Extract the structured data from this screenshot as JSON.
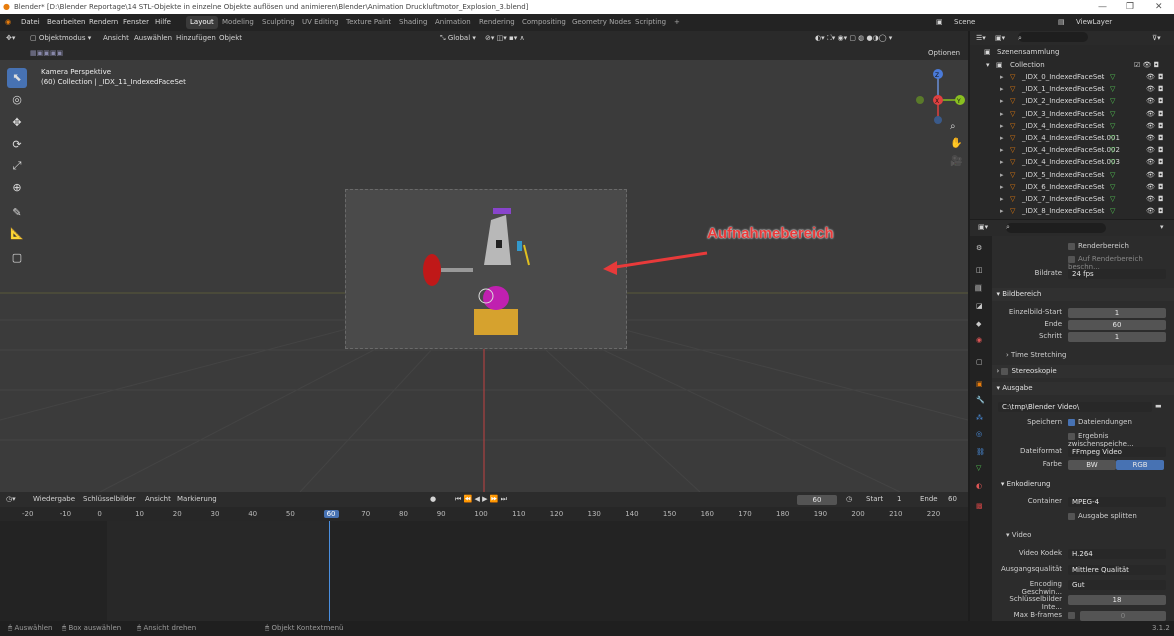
{
  "titlebar": {
    "title": "Blender* [D:\\Blender Reportage\\14 STL-Objekte in einzelne Objekte auflösen und animieren\\Blender\\Animation Druckluftmotor_Explosion_3.blend]",
    "minimize": "—",
    "maximize": "❐",
    "close": "✕"
  },
  "menu": [
    "Datei",
    "Bearbeiten",
    "Rendern",
    "Fenster",
    "Hilfe"
  ],
  "workspaces": [
    "Layout",
    "Modeling",
    "Sculpting",
    "UV Editing",
    "Texture Paint",
    "Shading",
    "Animation",
    "Rendering",
    "Compositing",
    "Geometry Nodes",
    "Scripting",
    "+"
  ],
  "scene": {
    "label": "Scene",
    "viewlayer": "ViewLayer"
  },
  "viewport_header": {
    "mode": "Objektmodus",
    "menus": [
      "Ansicht",
      "Auswählen",
      "Hinzufügen",
      "Objekt"
    ],
    "transform": "Global",
    "optionen": "Optionen"
  },
  "viewport": {
    "view_name": "Kamera Perspektive",
    "collection_line": "(60) Collection | _IDX_11_IndexedFaceSet",
    "annotation": "Aufnahmebereich",
    "gizmo": [
      "Z",
      "Y",
      "X"
    ]
  },
  "timeline": {
    "playback": "Wiedergabe",
    "keying": "Schlüsselbilder",
    "view": "Ansicht",
    "marker": "Markierung",
    "current_frame": "60",
    "start_label": "Start",
    "start": "1",
    "end_label": "Ende",
    "end": "60",
    "ticks": [
      "-20",
      "-10",
      "0",
      "10",
      "20",
      "30",
      "40",
      "50",
      "60",
      "70",
      "80",
      "90",
      "100",
      "110",
      "120",
      "130",
      "140",
      "150",
      "160",
      "170",
      "180",
      "190",
      "200",
      "210",
      "220"
    ]
  },
  "statusbar": {
    "select": "Auswählen",
    "box": "Box auswählen",
    "rotate": "Ansicht drehen",
    "context": "Objekt Kontextmenü",
    "version": "3.1.2"
  },
  "outliner": {
    "header": "Szenensammlung",
    "collection": "Collection",
    "items": [
      "_IDX_0_IndexedFaceSet",
      "_IDX_1_IndexedFaceSet",
      "_IDX_2_IndexedFaceSet",
      "_IDX_3_IndexedFaceSet",
      "_IDX_4_IndexedFaceSet",
      "_IDX_4_IndexedFaceSet.001",
      "_IDX_4_IndexedFaceSet.002",
      "_IDX_4_IndexedFaceSet.003",
      "_IDX_5_IndexedFaceSet",
      "_IDX_6_IndexedFaceSet",
      "_IDX_7_IndexedFaceSet",
      "_IDX_8_IndexedFaceSet"
    ]
  },
  "props": {
    "renderbereich": "Renderbereich",
    "auf_renderbereich": "Auf Renderbereich beschn...",
    "bildrate_label": "Bildrate",
    "bildrate": "24 fps",
    "bildbereich": "Bildbereich",
    "start_label": "Einzelbild-Start",
    "start": "1",
    "ende_label": "Ende",
    "ende": "60",
    "schritt_label": "Schritt",
    "schritt": "1",
    "time_stretching": "Time Stretching",
    "stereoskopie": "Stereoskopie",
    "ausgabe": "Ausgabe",
    "path": "C:\\tmp\\Blender Video\\",
    "speichern_label": "Speichern",
    "dateiendungen": "Dateiendungen",
    "ergebnis": "Ergebnis zwischenspeiche...",
    "dateiformat_label": "Dateiformat",
    "dateiformat": "FFmpeg Video",
    "farbe_label": "Farbe",
    "bw": "BW",
    "rgb": "RGB",
    "enkodierung": "Enkodierung",
    "container_label": "Container",
    "container": "MPEG-4",
    "ausgabe_splitten": "Ausgabe splitten",
    "video": "Video",
    "kodek_label": "Video Kodek",
    "kodek": "H.264",
    "qualitaet_label": "Ausgangsqualität",
    "qualitaet": "Mittlere Qualität",
    "geschw_label": "Encoding Geschwin...",
    "geschw": "Gut",
    "keyint_label": "Schlüsselbilder Inte...",
    "keyint": "18",
    "bframes_label": "Max B-frames",
    "bframes": "0"
  }
}
